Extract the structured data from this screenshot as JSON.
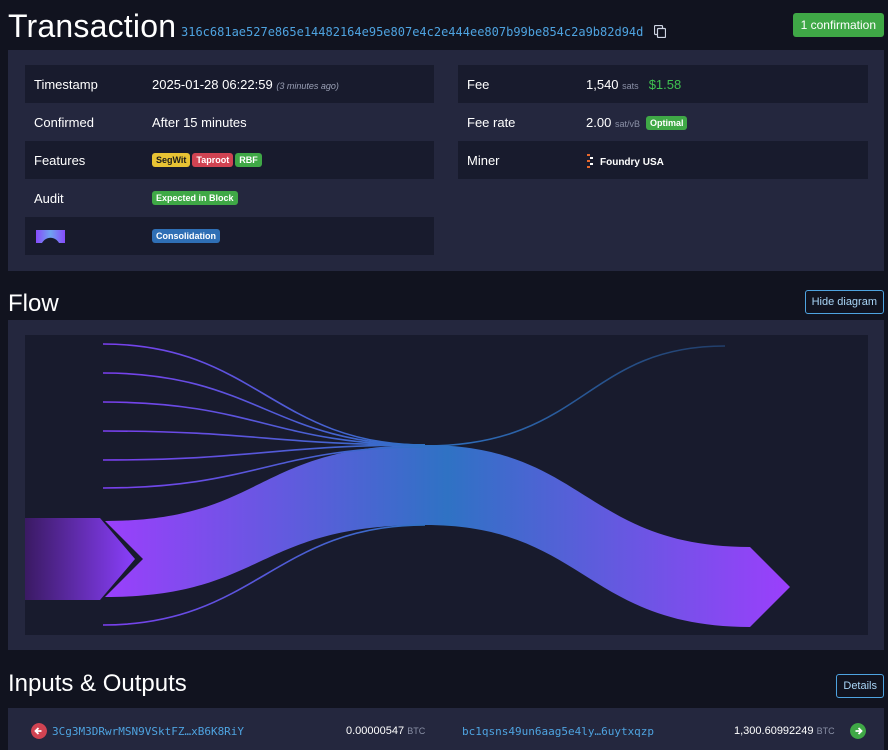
{
  "header": {
    "title": "Transaction",
    "txid": "316c681ae527e865e14482164e95e807e4c2e444ee807b99be854c2a9b82d94d",
    "confirmations": "1 confirmation"
  },
  "details": {
    "left": {
      "timestamp_label": "Timestamp",
      "timestamp_value": "2025-01-28 06:22:59",
      "timestamp_ago": "(3 minutes ago)",
      "confirmed_label": "Confirmed",
      "confirmed_value": "After 15 minutes",
      "features_label": "Features",
      "features": [
        "SegWit",
        "Taproot",
        "RBF"
      ],
      "audit_label": "Audit",
      "audit_value": "Expected in Block",
      "cluster_tag": "Consolidation"
    },
    "right": {
      "fee_label": "Fee",
      "fee_value": "1,540",
      "fee_unit": "sats",
      "fee_fiat": "$1.58",
      "feerate_label": "Fee rate",
      "feerate_value": "2.00",
      "feerate_unit": "sat/vB",
      "feerate_tag": "Optimal",
      "miner_label": "Miner",
      "miner_value": "Foundry USA"
    }
  },
  "flow": {
    "title": "Flow",
    "toggle_label": "Hide diagram",
    "colors": {
      "input": "#8a3ffc",
      "mid": "#2f6fb5",
      "output": "#9b3ffc"
    }
  },
  "io": {
    "title": "Inputs & Outputs",
    "details_label": "Details",
    "row": {
      "input_address": "3Cg3M3DRwrMSN9VSktFZ…xB6K8RiY",
      "input_amount": "0.00000547",
      "input_unit": "BTC",
      "output_address": "bc1qsns49un6aag5e4ly…6uytxqzp",
      "output_amount": "1,300.60992249",
      "output_unit": "BTC"
    }
  }
}
